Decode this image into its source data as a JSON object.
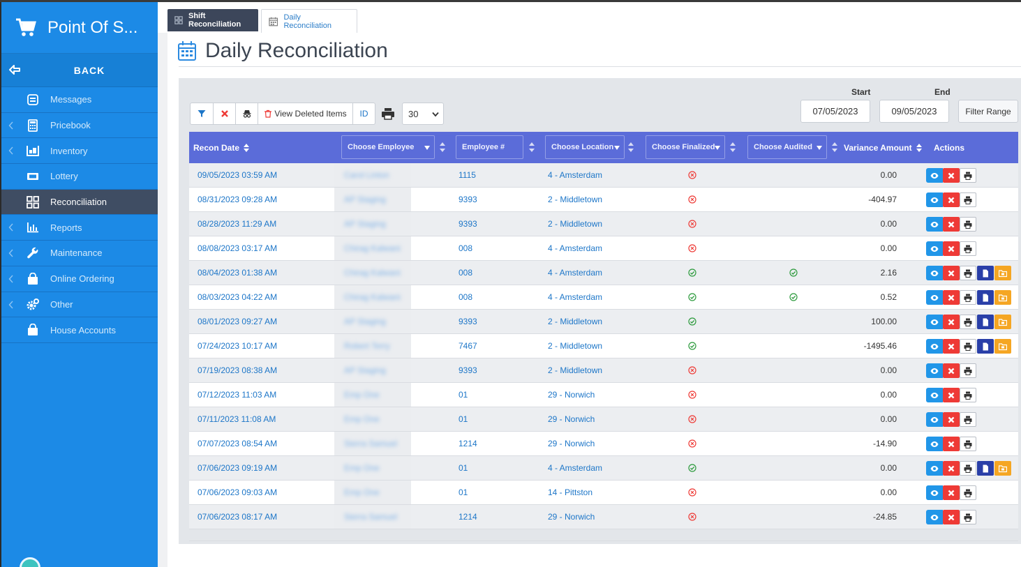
{
  "app": {
    "title": "Point Of S..."
  },
  "sidebar": {
    "back_label": "BACK",
    "items": [
      {
        "label": "Messages",
        "icon": "messages-icon",
        "has_chevron": false
      },
      {
        "label": "Pricebook",
        "icon": "calculator-icon",
        "has_chevron": true
      },
      {
        "label": "Inventory",
        "icon": "inventory-icon",
        "has_chevron": true
      },
      {
        "label": "Lottery",
        "icon": "ticket-icon",
        "has_chevron": false
      },
      {
        "label": "Reconciliation",
        "icon": "grid-icon",
        "has_chevron": false,
        "active": true
      },
      {
        "label": "Reports",
        "icon": "bar-chart-icon",
        "has_chevron": true
      },
      {
        "label": "Maintenance",
        "icon": "wrench-icon",
        "has_chevron": true
      },
      {
        "label": "Online Ordering",
        "icon": "shopping-bag-icon",
        "has_chevron": true
      },
      {
        "label": "Other",
        "icon": "gears-icon",
        "has_chevron": true
      },
      {
        "label": "House Accounts",
        "icon": "shopping-bag-icon",
        "has_chevron": false
      }
    ]
  },
  "tabs": [
    {
      "label": "Shift Reconciliation",
      "active": false
    },
    {
      "label": "Daily Reconciliation",
      "active": true
    }
  ],
  "page": {
    "title": "Daily Reconciliation"
  },
  "toolbar": {
    "view_deleted_label": "View Deleted Items",
    "id_label": "ID",
    "page_size": "30"
  },
  "range": {
    "start_label": "Start",
    "end_label": "End",
    "start_value": "07/05/2023",
    "end_value": "09/05/2023",
    "filter_label": "Filter Range"
  },
  "table": {
    "headers": {
      "recon_date": "Recon Date",
      "employee": "Choose Employee",
      "employee_num": "Employee #",
      "location": "Choose Location",
      "finalized": "Choose Finalized",
      "audited": "Choose Audited",
      "variance": "Variance Amount",
      "actions": "Actions"
    },
    "rows": [
      {
        "date": "09/05/2023 03:59 AM",
        "employee": "Carol Linton",
        "emp_num": "1115",
        "location": "4 - Amsterdam",
        "finalized": false,
        "audited": null,
        "variance": "0.00",
        "extra_actions": false
      },
      {
        "date": "08/31/2023 09:28 AM",
        "employee": "AP Staging",
        "emp_num": "9393",
        "location": "2 - Middletown",
        "finalized": false,
        "audited": null,
        "variance": "-404.97",
        "extra_actions": false
      },
      {
        "date": "08/28/2023 11:29 AM",
        "employee": "AP Staging",
        "emp_num": "9393",
        "location": "2 - Middletown",
        "finalized": false,
        "audited": null,
        "variance": "0.00",
        "extra_actions": false
      },
      {
        "date": "08/08/2023 03:17 AM",
        "employee": "Chirag Kalwani",
        "emp_num": "008",
        "location": "4 - Amsterdam",
        "finalized": false,
        "audited": null,
        "variance": "0.00",
        "extra_actions": false
      },
      {
        "date": "08/04/2023 01:38 AM",
        "employee": "Chirag Kalwani",
        "emp_num": "008",
        "location": "4 - Amsterdam",
        "finalized": true,
        "audited": true,
        "variance": "2.16",
        "extra_actions": true
      },
      {
        "date": "08/03/2023 04:22 AM",
        "employee": "Chirag Kalwani",
        "emp_num": "008",
        "location": "4 - Amsterdam",
        "finalized": true,
        "audited": true,
        "variance": "0.52",
        "extra_actions": true
      },
      {
        "date": "08/01/2023 09:27 AM",
        "employee": "AP Staging",
        "emp_num": "9393",
        "location": "2 - Middletown",
        "finalized": true,
        "audited": null,
        "variance": "100.00",
        "extra_actions": true
      },
      {
        "date": "07/24/2023 10:17 AM",
        "employee": "Robert Terry",
        "emp_num": "7467",
        "location": "2 - Middletown",
        "finalized": true,
        "audited": null,
        "variance": "-1495.46",
        "extra_actions": true
      },
      {
        "date": "07/19/2023 08:38 AM",
        "employee": "AP Staging",
        "emp_num": "9393",
        "location": "2 - Middletown",
        "finalized": false,
        "audited": null,
        "variance": "0.00",
        "extra_actions": false
      },
      {
        "date": "07/12/2023 11:03 AM",
        "employee": "Emp One",
        "emp_num": "01",
        "location": "29 - Norwich",
        "finalized": false,
        "audited": null,
        "variance": "0.00",
        "extra_actions": false
      },
      {
        "date": "07/11/2023 11:08 AM",
        "employee": "Emp One",
        "emp_num": "01",
        "location": "29 - Norwich",
        "finalized": false,
        "audited": null,
        "variance": "0.00",
        "extra_actions": false
      },
      {
        "date": "07/07/2023 08:54 AM",
        "employee": "Sierra Samuel",
        "emp_num": "1214",
        "location": "29 - Norwich",
        "finalized": false,
        "audited": null,
        "variance": "-14.90",
        "extra_actions": false
      },
      {
        "date": "07/06/2023 09:19 AM",
        "employee": "Emp One",
        "emp_num": "01",
        "location": "4 - Amsterdam",
        "finalized": true,
        "audited": null,
        "variance": "0.00",
        "extra_actions": true
      },
      {
        "date": "07/06/2023 09:03 AM",
        "employee": "Emp One",
        "emp_num": "01",
        "location": "14 - Pittston",
        "finalized": false,
        "audited": null,
        "variance": "0.00",
        "extra_actions": false
      },
      {
        "date": "07/06/2023 08:17 AM",
        "employee": "Sierra Samuel",
        "emp_num": "1214",
        "location": "29 - Norwich",
        "finalized": false,
        "audited": null,
        "variance": "-24.85",
        "extra_actions": false
      }
    ]
  },
  "colors": {
    "sidebar": "#1c8ae6",
    "header": "#5b6cd9",
    "link": "#1d76c8",
    "danger": "#ee3a36",
    "success": "#2c9a3c"
  }
}
